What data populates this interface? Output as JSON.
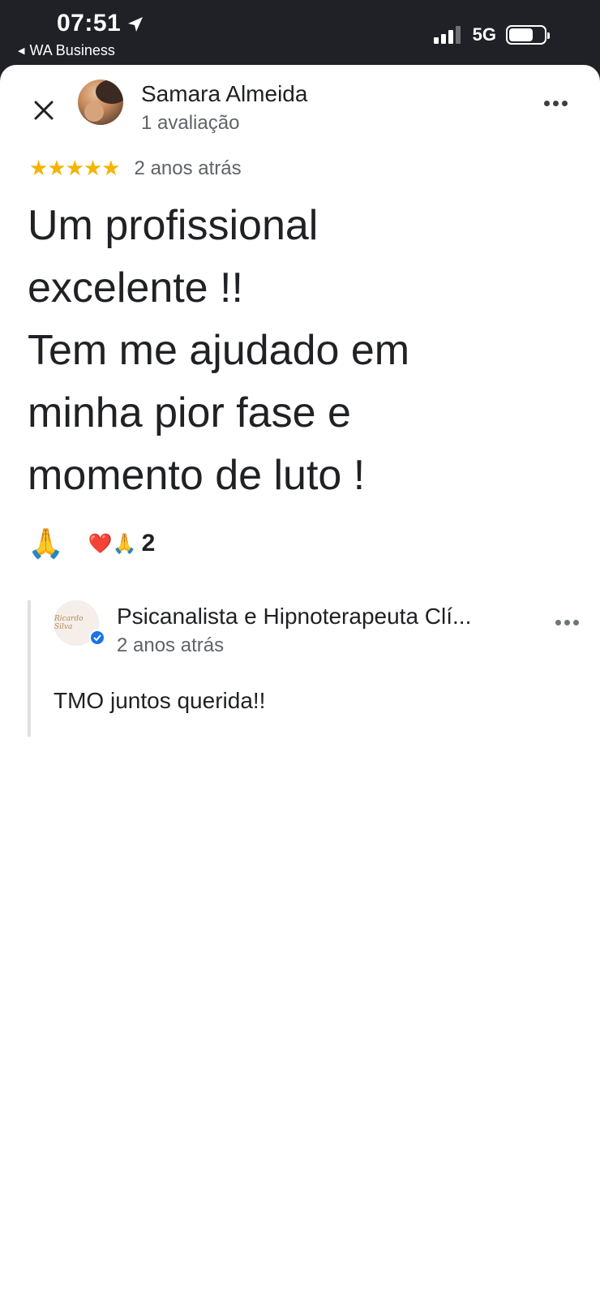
{
  "status_bar": {
    "time": "07:51",
    "back_app": "WA Business",
    "network": "5G"
  },
  "review": {
    "reviewer_name": "Samara Almeida",
    "reviewer_count": "1 avaliação",
    "stars": "★★★★★",
    "rating": 5,
    "date": "2 anos atrás",
    "text": "Um profissional\nexcelente !!\nTem me ajudado em\nminha pior fase e\nmomento de luto !",
    "react_button": "🙏",
    "reaction_emojis": "❤️🙏",
    "reaction_count": "2"
  },
  "owner_reply": {
    "name": "Psicanalista e Hipnoterapeuta Clí...",
    "date": "2 anos atrás",
    "text": "TMO juntos querida!!",
    "logo_text": "Ricardo Silva"
  },
  "colors": {
    "star": "#f4b400",
    "status_bar_bg": "#202126",
    "verified": "#1a73e8"
  }
}
